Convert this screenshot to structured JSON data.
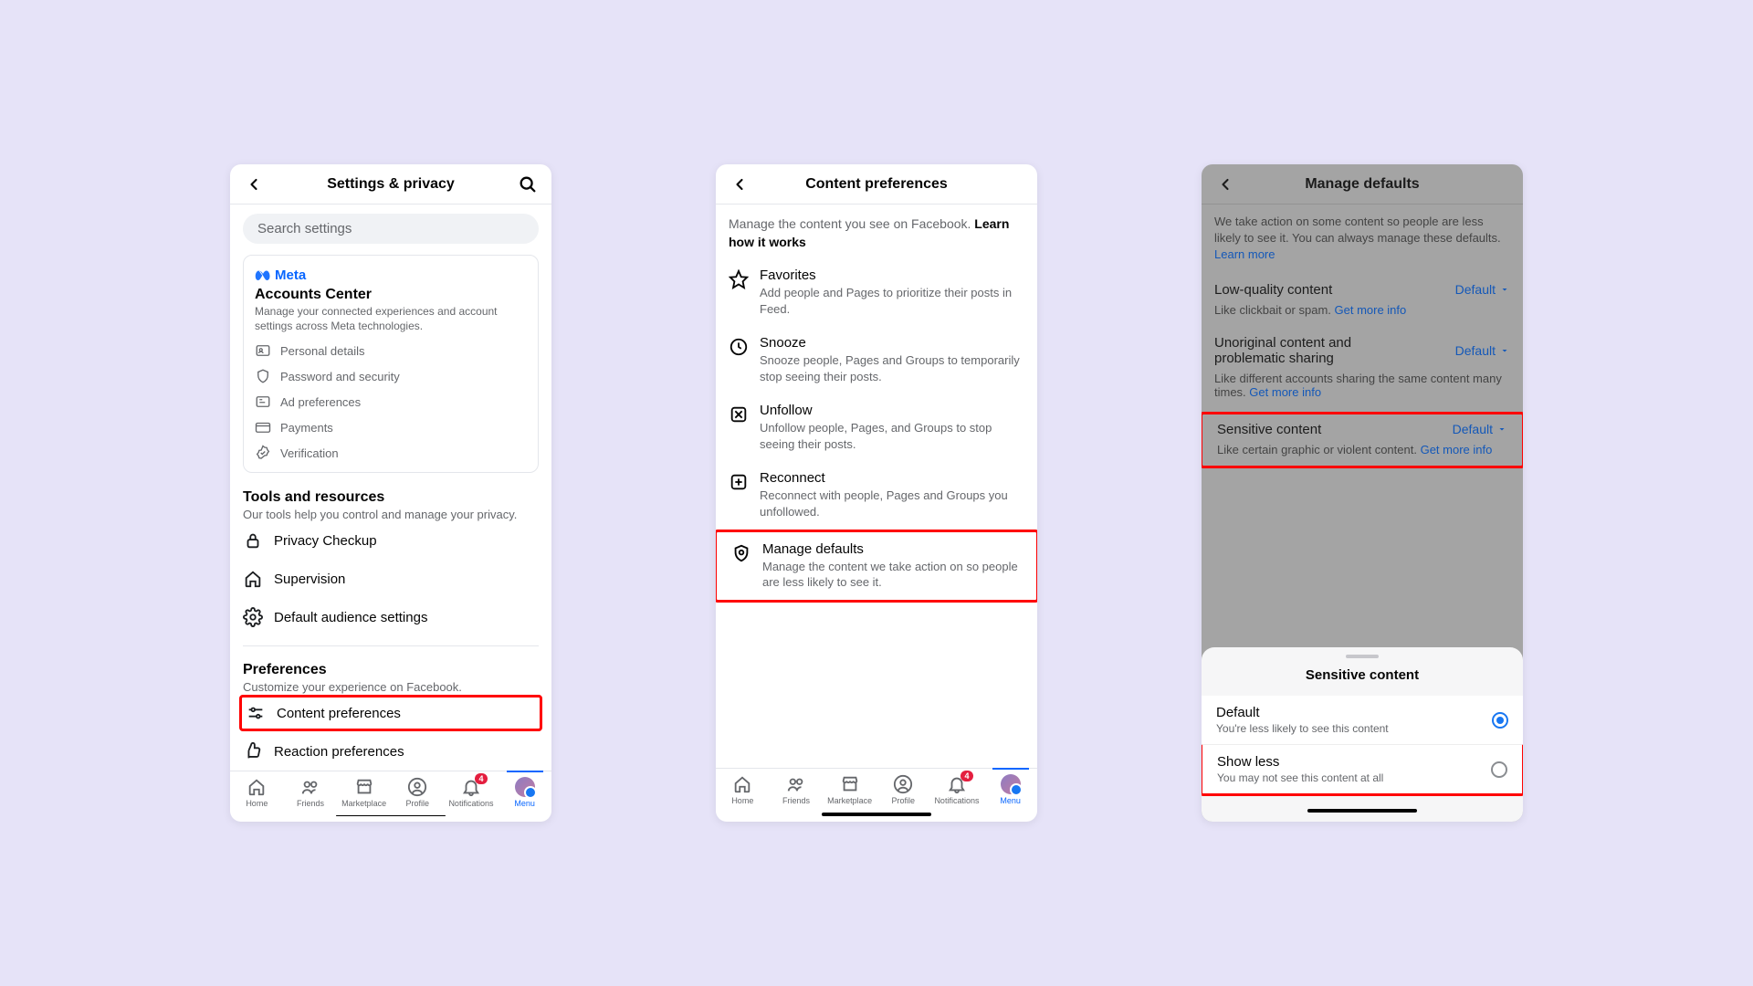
{
  "screen1": {
    "title": "Settings & privacy",
    "search_placeholder": "Search settings",
    "meta_brand": "Meta",
    "accounts_center": {
      "title": "Accounts Center",
      "subtitle": "Manage your connected experiences and account settings across Meta technologies.",
      "items": [
        "Personal details",
        "Password and security",
        "Ad preferences",
        "Payments",
        "Verification"
      ]
    },
    "tools": {
      "title": "Tools and resources",
      "subtitle": "Our tools help you control and manage your privacy.",
      "items": [
        "Privacy Checkup",
        "Supervision",
        "Default audience settings"
      ]
    },
    "preferences": {
      "title": "Preferences",
      "subtitle": "Customize your experience on Facebook.",
      "items": [
        "Content preferences",
        "Reaction preferences"
      ]
    },
    "nav": {
      "home": "Home",
      "friends": "Friends",
      "marketplace": "Marketplace",
      "profile": "Profile",
      "notifications": "Notifications",
      "menu": "Menu",
      "notif_badge": "4"
    }
  },
  "screen2": {
    "title": "Content preferences",
    "intro_text": "Manage the content you see on Facebook. ",
    "intro_link": "Learn how it works",
    "items": [
      {
        "title": "Favorites",
        "sub": "Add people and Pages to prioritize their posts in Feed."
      },
      {
        "title": "Snooze",
        "sub": "Snooze people, Pages and Groups to temporarily stop seeing their posts."
      },
      {
        "title": "Unfollow",
        "sub": "Unfollow people, Pages, and Groups to stop seeing their posts."
      },
      {
        "title": "Reconnect",
        "sub": "Reconnect with people, Pages and Groups you unfollowed."
      },
      {
        "title": "Manage defaults",
        "sub": "Manage the content we take action on so people are less likely to see it."
      }
    ]
  },
  "screen3": {
    "title": "Manage defaults",
    "intro": "We take action on some content so people are less likely to see it. You can always manage these defaults. ",
    "learn_more": "Learn more",
    "rows": [
      {
        "label": "Low-quality content",
        "sel": "Default",
        "desc": "Like clickbait or spam. ",
        "gmi": "Get more info"
      },
      {
        "label": "Unoriginal content and problematic sharing",
        "sel": "Default",
        "desc": "Like different accounts sharing the same content many times. ",
        "gmi": "Get more info"
      },
      {
        "label": "Sensitive content",
        "sel": "Default",
        "desc": "Like certain graphic or violent content. ",
        "gmi": "Get more info"
      }
    ],
    "sheet": {
      "title": "Sensitive content",
      "options": [
        {
          "t": "Default",
          "s": "You're less likely to see this content",
          "checked": true
        },
        {
          "t": "Show less",
          "s": "You may not see this content at all",
          "checked": false
        }
      ]
    }
  }
}
